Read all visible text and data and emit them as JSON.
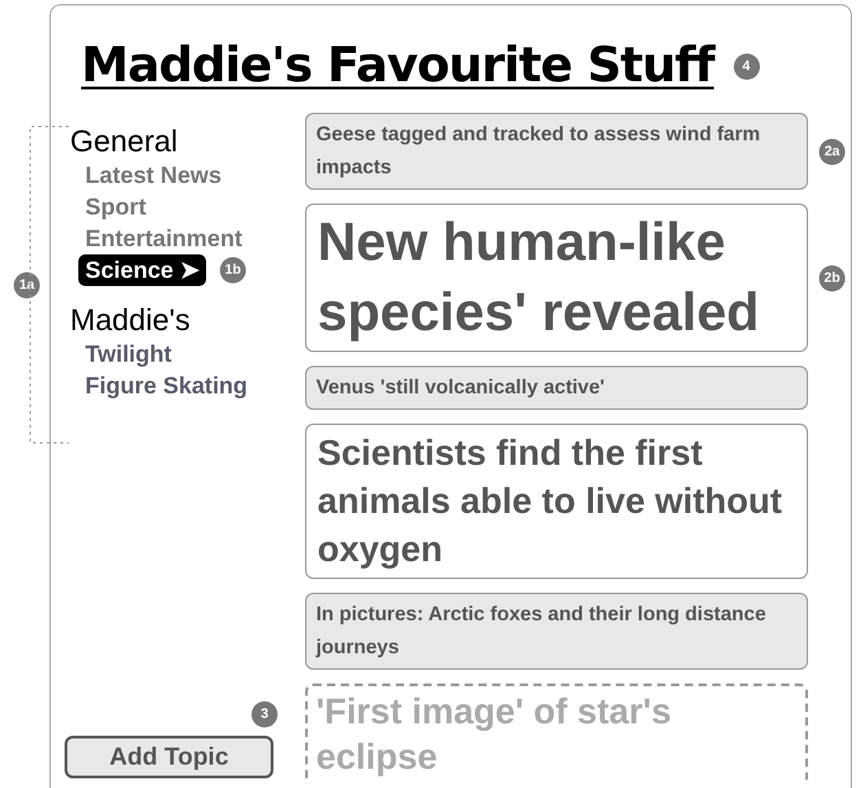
{
  "title": {
    "text": "Maddie's Favourite Stuff",
    "badge": "4"
  },
  "nav": {
    "badge": "1a",
    "groups": [
      {
        "heading": "General",
        "kind": "builtin",
        "items": [
          {
            "label": "Latest News",
            "selected": false
          },
          {
            "label": "Sport",
            "selected": false
          },
          {
            "label": "Entertainment",
            "selected": false
          },
          {
            "label": "Science ➤",
            "selected": true,
            "badge": "1b"
          }
        ]
      },
      {
        "heading": "Maddie's",
        "kind": "custom",
        "items": [
          {
            "label": "Twilight",
            "selected": false
          },
          {
            "label": "Figure Skating",
            "selected": false
          }
        ]
      }
    ]
  },
  "articles": [
    {
      "kind": "small",
      "text": "Geese tagged and tracked to assess wind farm impacts",
      "badge": "2a"
    },
    {
      "kind": "large",
      "text": "New human-like species' revealed",
      "badge": "2b"
    },
    {
      "kind": "small",
      "text": "Venus 'still volcanically active'"
    },
    {
      "kind": "medium",
      "text": "Scientists find the first animals able to live without oxygen"
    },
    {
      "kind": "small",
      "text": "In pictures: Arctic foxes and their long distance journeys"
    },
    {
      "kind": "draft",
      "text": "'First image' of star's eclipse"
    }
  ],
  "add_topic": {
    "label": "Add Topic",
    "badge": "3"
  }
}
